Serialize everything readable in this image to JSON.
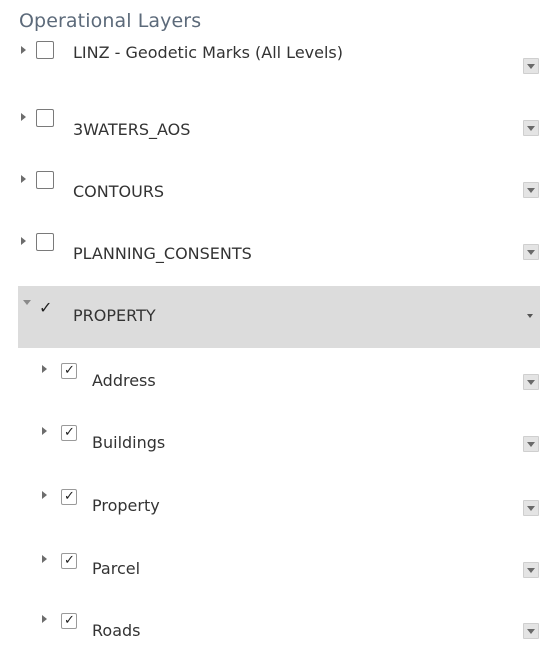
{
  "panel": {
    "title": "Operational Layers"
  },
  "layers": [
    {
      "label": "LINZ - Geodetic Marks (All Levels)",
      "checked": false
    },
    {
      "label": "3WATERS_AOS",
      "checked": false
    },
    {
      "label": "CONTOURS",
      "checked": false
    },
    {
      "label": "PLANNING_CONSENTS",
      "checked": false
    },
    {
      "label": "PROPERTY",
      "checked": true,
      "expanded": true
    }
  ],
  "sublayers": [
    {
      "label": "Address",
      "checked": true
    },
    {
      "label": "Buildings",
      "checked": true
    },
    {
      "label": "Property",
      "checked": true
    },
    {
      "label": "Parcel",
      "checked": true
    },
    {
      "label": "Roads",
      "checked": true
    }
  ],
  "check_glyph": "✓",
  "colors": {
    "selected_row": "#dcdcdc",
    "header_text": "#5c6a7a"
  },
  "icons": {
    "expand": "triangle-right-icon",
    "collapse": "triangle-down-icon",
    "menu": "dropdown-menu-icon"
  }
}
